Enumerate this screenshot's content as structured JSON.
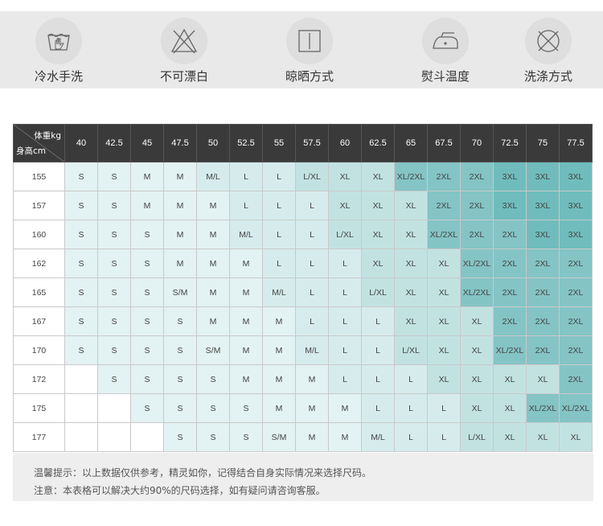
{
  "care": [
    {
      "icon": "hand-wash-icon",
      "label": "冷水手洗"
    },
    {
      "icon": "no-bleach-icon",
      "label": "不可漂白"
    },
    {
      "icon": "drip-dry-icon",
      "label": "晾晒方式"
    },
    {
      "icon": "iron-icon",
      "label": "熨斗温度"
    },
    {
      "icon": "no-dry-clean-icon",
      "label": "洗涤方式"
    }
  ],
  "table": {
    "corner_weight": "体重kg",
    "corner_height": "身高cm",
    "weights": [
      "40",
      "42.5",
      "45",
      "47.5",
      "50",
      "52.5",
      "55",
      "57.5",
      "60",
      "62.5",
      "65",
      "67.5",
      "70",
      "72.5",
      "75",
      "77.5"
    ],
    "rows": [
      {
        "height": "155",
        "sizes": [
          "S",
          "S",
          "M",
          "M",
          "M/L",
          "L",
          "L",
          "L/XL",
          "XL",
          "XL",
          "XL/2XL",
          "2XL",
          "2XL",
          "3XL",
          "3XL",
          "3XL"
        ]
      },
      {
        "height": "157",
        "sizes": [
          "S",
          "S",
          "M",
          "M",
          "M",
          "L",
          "L",
          "L",
          "XL",
          "XL",
          "XL",
          "2XL",
          "2XL",
          "3XL",
          "3XL",
          "3XL"
        ]
      },
      {
        "height": "160",
        "sizes": [
          "S",
          "S",
          "S",
          "M",
          "M",
          "M/L",
          "L",
          "L",
          "L/XL",
          "XL",
          "XL",
          "XL/2XL",
          "2XL",
          "2XL",
          "3XL",
          "3XL"
        ]
      },
      {
        "height": "162",
        "sizes": [
          "S",
          "S",
          "S",
          "M",
          "M",
          "M",
          "L",
          "L",
          "L",
          "XL",
          "XL",
          "XL",
          "XL/2XL",
          "2XL",
          "2XL",
          "2XL"
        ]
      },
      {
        "height": "165",
        "sizes": [
          "S",
          "S",
          "S",
          "S/M",
          "M",
          "M",
          "M/L",
          "L",
          "L",
          "L/XL",
          "XL",
          "XL",
          "XL/2XL",
          "2XL",
          "2XL",
          "2XL"
        ]
      },
      {
        "height": "167",
        "sizes": [
          "S",
          "S",
          "S",
          "S",
          "M",
          "M",
          "M",
          "L",
          "L",
          "L",
          "XL",
          "XL",
          "XL",
          "2XL",
          "2XL",
          "2XL"
        ]
      },
      {
        "height": "170",
        "sizes": [
          "S",
          "S",
          "S",
          "S",
          "S/M",
          "M",
          "M",
          "M/L",
          "L",
          "L",
          "L/XL",
          "XL",
          "XL",
          "XL/2XL",
          "2XL",
          "2XL"
        ]
      },
      {
        "height": "172",
        "sizes": [
          "",
          "S",
          "S",
          "S",
          "S",
          "M",
          "M",
          "M",
          "L",
          "L",
          "L",
          "XL",
          "XL",
          "XL",
          "XL",
          "2XL"
        ]
      },
      {
        "height": "175",
        "sizes": [
          "",
          "",
          "S",
          "S",
          "S",
          "S",
          "M",
          "M",
          "M",
          "L",
          "L",
          "L",
          "XL",
          "XL",
          "XL/2XL",
          "XL/2XL"
        ]
      },
      {
        "height": "177",
        "sizes": [
          "",
          "",
          "",
          "S",
          "S",
          "S",
          "S/M",
          "M",
          "M",
          "M/L",
          "L",
          "L",
          "L/XL",
          "XL",
          "XL",
          "XL"
        ]
      }
    ]
  },
  "notes": [
    "温馨提示：以上数据仅供参考，精灵如你，记得结合自身实际情况来选择尺码。",
    "注意：本表格可以解决大约90%的尺码选择，如有疑问请咨询客服。"
  ]
}
